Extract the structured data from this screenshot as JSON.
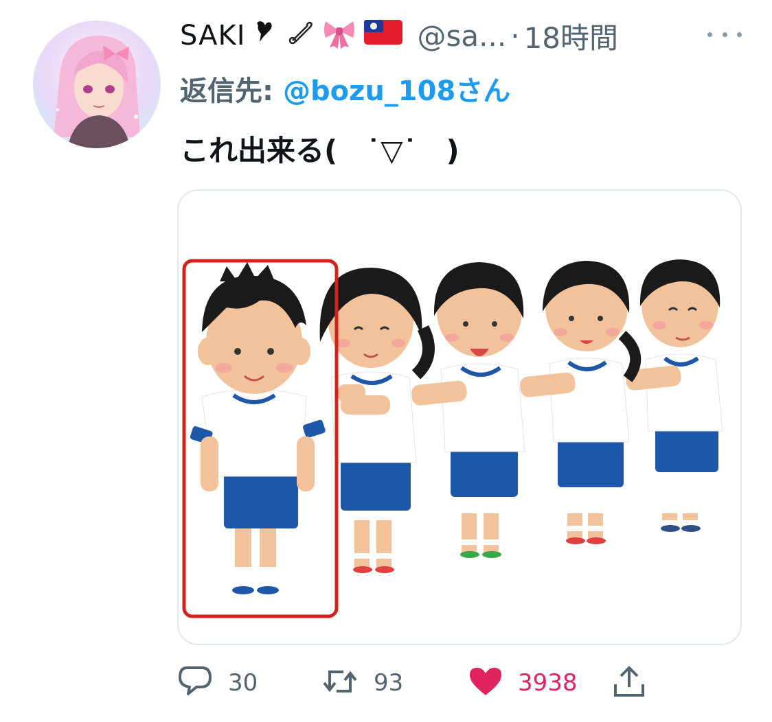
{
  "tweet": {
    "display_name": "SAKI",
    "handle": "@sa...",
    "separator": "·",
    "timestamp": "18時間",
    "reply_label": "返信先:",
    "reply_mention": "@bozu_108さん",
    "text": "これ出来る(　˙▽˙　)"
  },
  "actions": {
    "reply_count": "30",
    "retweet_count": "93",
    "like_count": "3938"
  },
  "icons": {
    "reply": "reply-icon",
    "retweet": "retweet-icon",
    "like": "heart-icon",
    "share": "share-icon",
    "more": "more-icon"
  },
  "colors": {
    "text": "#0f1419",
    "secondary": "#536471",
    "link": "#1d9bf0",
    "like": "#e0245e",
    "highlight_box": "#d0231f"
  }
}
